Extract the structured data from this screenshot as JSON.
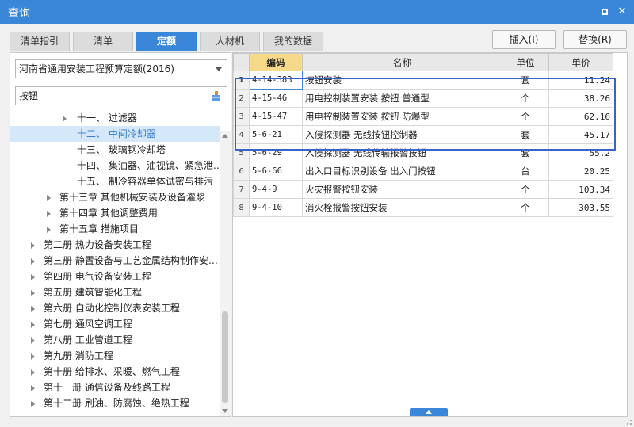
{
  "window": {
    "title": "查询"
  },
  "tabs": [
    {
      "label": "清单指引"
    },
    {
      "label": "清单"
    },
    {
      "label": "定额"
    },
    {
      "label": "人材机"
    },
    {
      "label": "我的数据"
    }
  ],
  "active_tab": "定额",
  "buttons": {
    "insert": "插入(I)",
    "replace": "替换(R)"
  },
  "left": {
    "quota_db_select": "河南省通用安装工程预算定额(2016)",
    "search_value": "按钮",
    "tree": [
      {
        "label": "十一、 过滤器",
        "has_children": true
      },
      {
        "label": "十二、 中间冷却器",
        "has_children": false,
        "selected": true
      },
      {
        "label": "十三、 玻璃钢冷却塔",
        "has_children": false
      },
      {
        "label": "十四、 集油器、油视镜、紧急泄…",
        "has_children": false
      },
      {
        "label": "十五、 制冷容器单体试密与排污",
        "has_children": false
      },
      {
        "label": "第十三章 其他机械安装及设备灌浆",
        "has_children": true
      },
      {
        "label": "第十四章 其他调整费用",
        "has_children": true
      },
      {
        "label": "第十五章 措施项目",
        "has_children": true
      },
      {
        "label": "第二册 热力设备安装工程",
        "has_children": true
      },
      {
        "label": "第三册 静置设备与工艺金属结构制作安…",
        "has_children": true
      },
      {
        "label": "第四册 电气设备安装工程",
        "has_children": true
      },
      {
        "label": "第五册 建筑智能化工程",
        "has_children": true
      },
      {
        "label": "第六册 自动化控制仪表安装工程",
        "has_children": true
      },
      {
        "label": "第七册 通风空调工程",
        "has_children": true
      },
      {
        "label": "第八册 工业管道工程",
        "has_children": true
      },
      {
        "label": "第九册 消防工程",
        "has_children": true
      },
      {
        "label": "第十册 给排水、采暖、燃气工程",
        "has_children": true
      },
      {
        "label": "第十一册 通信设备及线路工程",
        "has_children": true
      },
      {
        "label": "第十二册 刷油、防腐蚀、绝热工程",
        "has_children": true
      }
    ]
  },
  "grid": {
    "columns": [
      "编码",
      "名称",
      "单位",
      "单价"
    ],
    "rows": [
      {
        "num": "1",
        "code": "4-14-383",
        "name": "按钮安装",
        "unit": "套",
        "price": "11.24"
      },
      {
        "num": "2",
        "code": "4-15-46",
        "name": "用电控制装置安装 按钮 普通型",
        "unit": "个",
        "price": "38.26"
      },
      {
        "num": "3",
        "code": "4-15-47",
        "name": "用电控制装置安装 按钮 防爆型",
        "unit": "个",
        "price": "62.16"
      },
      {
        "num": "4",
        "code": "5-6-21",
        "name": "入侵探测器 无线按钮控制器",
        "unit": "套",
        "price": "45.17"
      },
      {
        "num": "5",
        "code": "5-6-29",
        "name": "入侵探测器 无线传输报警按钮",
        "unit": "套",
        "price": "55.2"
      },
      {
        "num": "6",
        "code": "5-6-66",
        "name": "出入口目标识别设备 出入门按钮",
        "unit": "台",
        "price": "20.25"
      },
      {
        "num": "7",
        "code": "9-4-9",
        "name": "火灾报警按钮安装",
        "unit": "个",
        "price": "103.34"
      },
      {
        "num": "8",
        "code": "9-4-10",
        "name": "消火栓报警按钮安装",
        "unit": "个",
        "price": "303.55"
      }
    ]
  },
  "colors": {
    "accent": "#3a86d8",
    "highlight_box": "#3565c8",
    "active_col_header": "#f7d98a",
    "selected_tree": "#d4e8fa"
  }
}
